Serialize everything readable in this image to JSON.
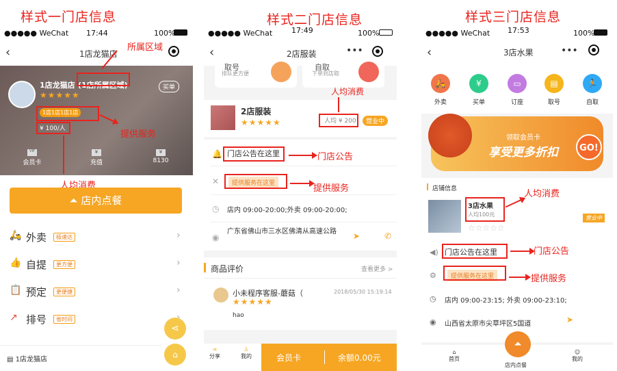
{
  "titles": {
    "style1": "样式一门店信息",
    "style2": "样式二门店信息",
    "style3": "样式三门店信息"
  },
  "status": {
    "carrier": "●●●●● WeChat",
    "battery": "100%"
  },
  "p1": {
    "time": "17:44",
    "nav_title": "1店龙猫店",
    "store_name": "1店龙猫店",
    "region": "(1店所属区域)",
    "btn": "买单",
    "services": "1店1店1店1店",
    "avg": "¥ 100/人",
    "tabs": [
      {
        "label": "会员卡",
        "icon": "VIP"
      },
      {
        "label": "充值",
        "icon": "¥"
      },
      {
        "label": "8130",
        "icon": "¥"
      }
    ],
    "order_btn": "店内点餐",
    "menu": [
      {
        "label": "外卖",
        "tag": "极速达",
        "icon": "🛵"
      },
      {
        "label": "自提",
        "tag": "更方便",
        "icon": "👍"
      },
      {
        "label": "预定",
        "tag": "更便捷",
        "icon": "📋"
      },
      {
        "label": "排号",
        "tag": "省时间",
        "icon": "↗"
      }
    ],
    "footer_store": "1店龙猫店",
    "ann_region": "所属区域",
    "ann_service": "提供服务",
    "ann_avg": "人均消费"
  },
  "p2": {
    "time": "17:49",
    "nav_title": "2店服装",
    "top_left_title": "取号",
    "top_left_sub": "排队更方便",
    "top_right_title": "自取",
    "top_right_sub": "下单到店取",
    "store_name": "2店服装",
    "avg": "人均 ¥ 200",
    "open": "营业中",
    "notice": "门店公告在这里",
    "service": "提供服务在这里",
    "hours": "店内 09:00-20:00;外卖 09:00-20:00;",
    "address": "广东省佛山市三水区佛清从高速公路",
    "review_title": "商品评价",
    "more": "查看更多 >",
    "reviewer": "小未程序客服-蘑菇（",
    "review_date": "2018/05/30 15:19:14",
    "review_text": "hao",
    "tab_share": "分享",
    "tab_mine": "我的",
    "member_card": "会员卡",
    "balance": "余额0.00元",
    "ann_avg": "人均消费",
    "ann_notice": "门店公告",
    "ann_service": "提供服务"
  },
  "p3": {
    "time": "17:53",
    "nav_title": "3店水果",
    "icons": [
      {
        "label": "外卖",
        "color": "#f0764a",
        "icon": "🛵"
      },
      {
        "label": "买单",
        "color": "#2ecc8b",
        "icon": "¥"
      },
      {
        "label": "订座",
        "color": "#c27be0",
        "icon": "▭"
      },
      {
        "label": "取号",
        "color": "#f5b51b",
        "icon": "▤"
      },
      {
        "label": "自取",
        "color": "#2fa9f5",
        "icon": "🏃"
      }
    ],
    "banner_small": "领取会员卡",
    "banner_big": "享受更多折扣",
    "banner_btn": "GO!",
    "section": "店铺信息",
    "store_name": "3店水果",
    "avg": "人均100元",
    "open": "营业中",
    "notice": "门店公告在这里",
    "service": "提供服务在这里",
    "hours": "店内 09:00-23:15; 外卖 09:00-23:10;",
    "address": "山西省太原市尖草坪区5国道",
    "tabs": [
      "首页",
      "店内点餐",
      "我的"
    ],
    "ann_avg": "人均消费",
    "ann_notice": "门店公告",
    "ann_service": "提供服务"
  }
}
